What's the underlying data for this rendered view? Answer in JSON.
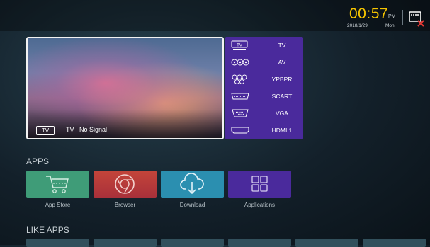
{
  "status_bar": {
    "time": "00:57",
    "ampm": "PM",
    "date": "2018/1/29",
    "day": "Mon.",
    "usb_icon": "usb-disconnected-icon",
    "accent_color": "#f5c400"
  },
  "preview": {
    "source_badge": "TV",
    "source_name": "TV",
    "status_text": "No Signal"
  },
  "sources": [
    {
      "label": "TV",
      "icon": "tv-icon"
    },
    {
      "label": "AV",
      "icon": "av-icon"
    },
    {
      "label": "YPBPR",
      "icon": "ypbpr-icon"
    },
    {
      "label": "SCART",
      "icon": "scart-icon"
    },
    {
      "label": "VGA",
      "icon": "vga-icon"
    },
    {
      "label": "HDMI 1",
      "icon": "hdmi-icon"
    }
  ],
  "apps": {
    "title": "APPS",
    "items": [
      {
        "label": "App Store",
        "icon": "cart-icon",
        "color": "#3f9c78"
      },
      {
        "label": "Browser",
        "icon": "browser-icon",
        "color": "#c4453a"
      },
      {
        "label": "Download",
        "icon": "cloud-download-icon",
        "color": "#2b8fb0"
      },
      {
        "label": "Applications",
        "icon": "grid-icon",
        "color": "#4a2a9c"
      }
    ]
  },
  "like_apps": {
    "title": "LIKE APPS"
  }
}
